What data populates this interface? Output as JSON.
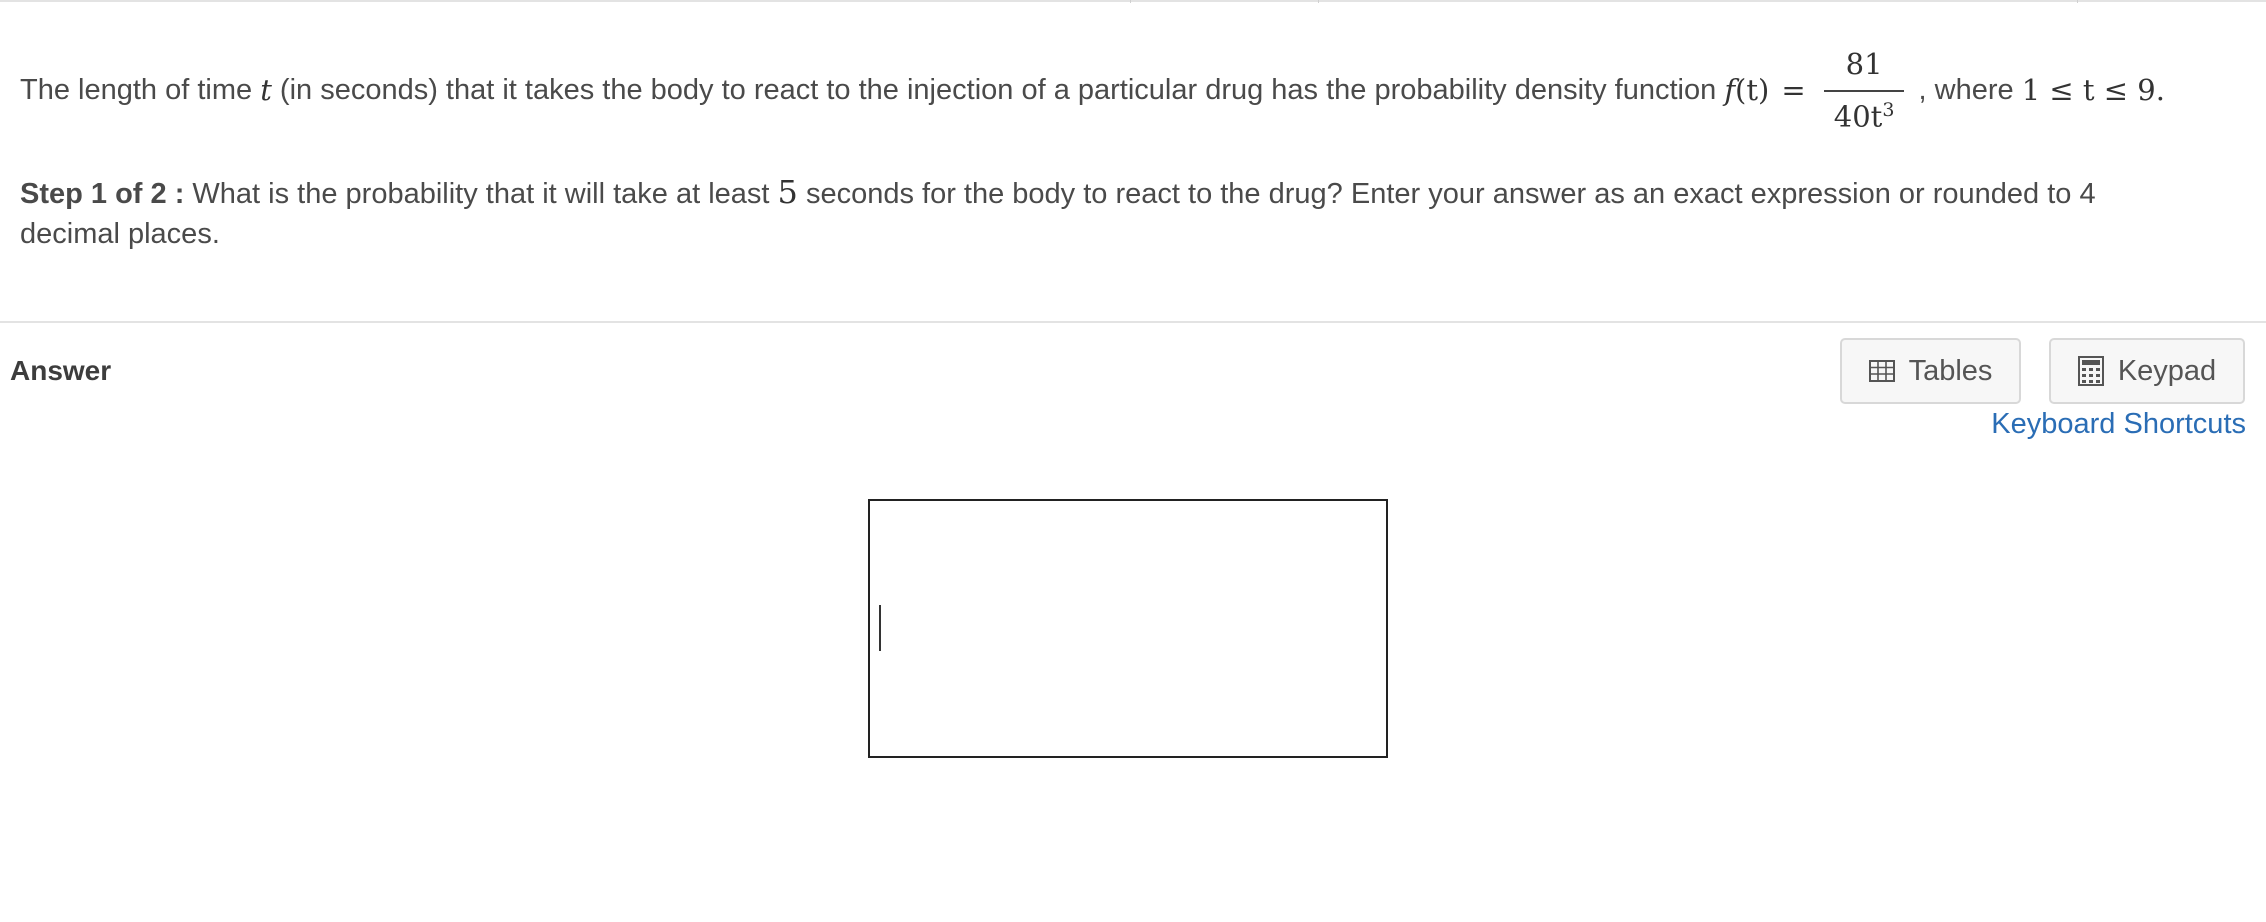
{
  "problem": {
    "intro": "The length of time",
    "var_t": "t",
    "after_t": "(in seconds) that it takes the body to react to the injection of a particular drug has the probability density function",
    "func": "f",
    "func_arg": "(t)",
    "equals": "=",
    "numerator": "81",
    "denominator_base": "40t",
    "denominator_exp": "3",
    "comma": ",",
    "where": "where",
    "domain_expr": "1 ≤ t ≤ 9."
  },
  "step": {
    "label": "Step 1 of 2 :",
    "text_before": "What is the probability that it will take at least",
    "value": "5",
    "text_after": "seconds for the body to react to the drug? Enter your answer as an exact expression or rounded to 4 decimal places."
  },
  "answer": {
    "label": "Answer",
    "tables_label": "Tables",
    "keypad_label": "Keypad",
    "shortcuts_label": "Keyboard Shortcuts",
    "input_value": ""
  },
  "icons": {
    "tables": "table-icon",
    "keypad": "calculator-icon"
  },
  "colors": {
    "link": "#2a6db5",
    "text": "#4a4a4a",
    "button_bg": "#f7f7f7",
    "button_border": "#d8d8d8"
  }
}
